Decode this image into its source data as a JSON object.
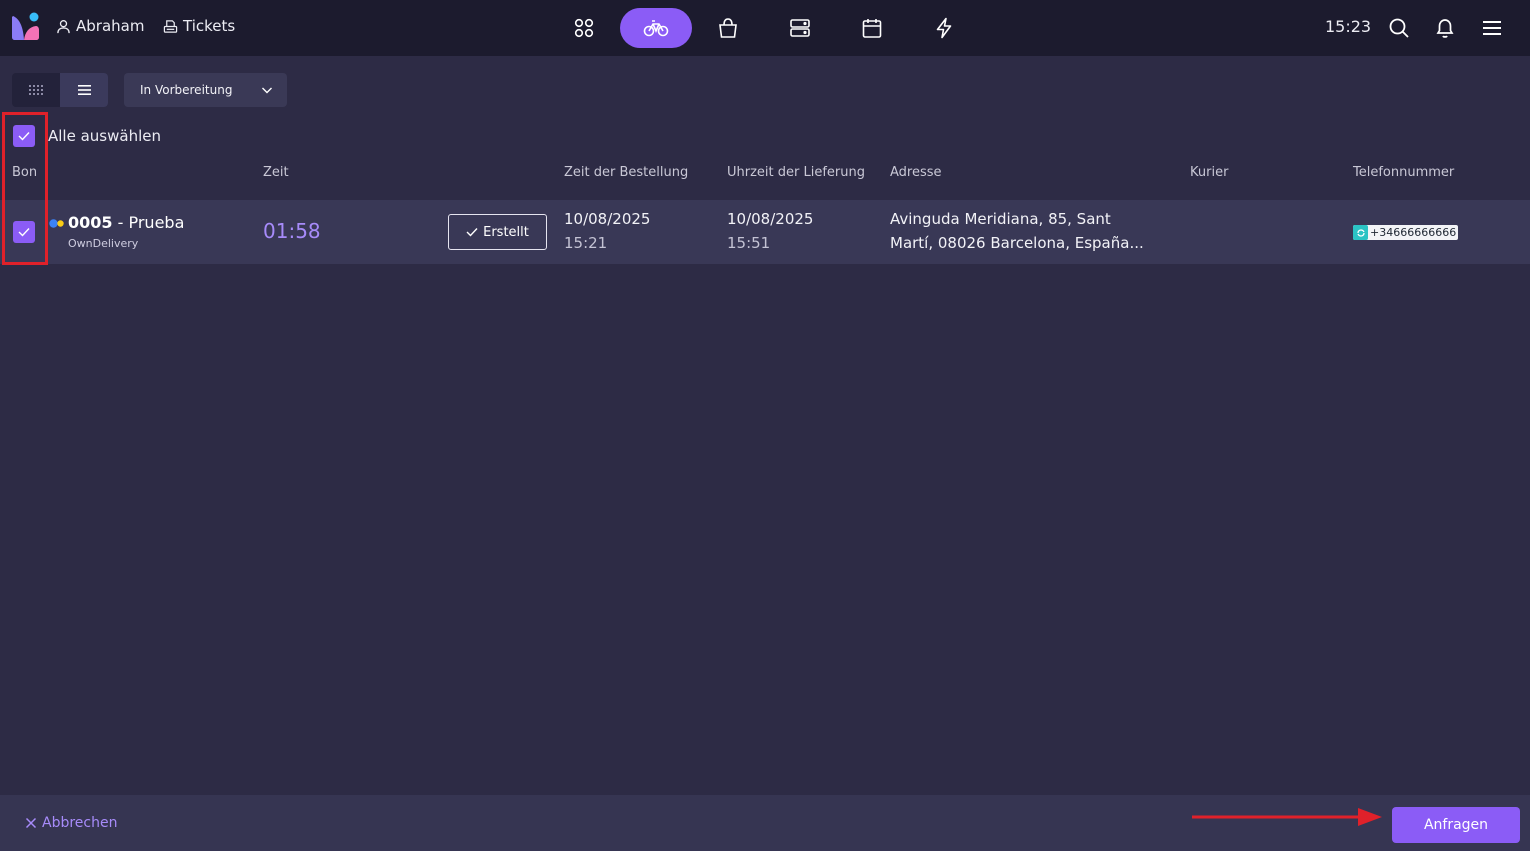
{
  "header": {
    "user_name": "Abraham",
    "tickets_label": "Tickets",
    "time": "15:23",
    "nav": [
      {
        "icon": "grid-apps-icon",
        "active": false
      },
      {
        "icon": "bicycle-icon",
        "active": true
      },
      {
        "icon": "shopping-bag-icon",
        "active": false
      },
      {
        "icon": "server-icon",
        "active": false
      },
      {
        "icon": "calendar-icon",
        "active": false
      },
      {
        "icon": "lightning-icon",
        "active": false
      }
    ],
    "right_icons": [
      "search-icon",
      "bell-icon",
      "hamburger-menu-icon"
    ]
  },
  "toolbar": {
    "view_modes": [
      "grid-view-icon",
      "list-view-icon"
    ],
    "selected_view": "list",
    "status_filter": "In Vorbereitung"
  },
  "selection": {
    "select_all_label": "Alle auswählen",
    "all_selected": true
  },
  "table": {
    "columns": {
      "bon": "Bon",
      "zeit": "Zeit",
      "order_time": "Zeit der Bestellung",
      "delivery_time": "Uhrzeit der Lieferung",
      "address": "Adresse",
      "courier": "Kurier",
      "phone": "Telefonnummer"
    },
    "rows": [
      {
        "selected": true,
        "order_number": "0005",
        "order_separator": " - ",
        "customer": "Prueba",
        "channel": "OwnDelivery",
        "timer": "01:58",
        "status_label": "Erstellt",
        "order_date": "10/08/2025",
        "order_clock": "15:21",
        "delivery_date": "10/08/2025",
        "delivery_clock": "15:51",
        "address_line1": "Avinguda Meridiana, 85, Sant",
        "address_line2": "Martí, 08026 Barcelona, España...",
        "courier": "",
        "phone": "+34666666666"
      }
    ]
  },
  "footer": {
    "cancel_label": "Abbrechen",
    "request_label": "Anfragen"
  },
  "colors": {
    "accent": "#8b5cf6",
    "background": "#2d2b45",
    "topbar": "#1c1b2e",
    "annotation": "#e0212a"
  }
}
